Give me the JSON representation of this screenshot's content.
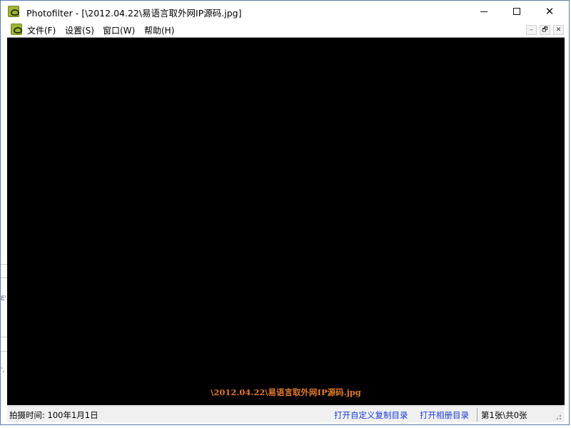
{
  "window": {
    "title": "Photofilter - [\\2012.04.22\\易语言取外网IP源码.jpg]"
  },
  "caption_buttons": {
    "minimize_icon": "minimize-icon",
    "maximize_icon": "maximize-icon",
    "close_icon": "close-icon"
  },
  "menu": {
    "items": [
      {
        "label": "文件(F)"
      },
      {
        "label": "设置(S)"
      },
      {
        "label": "窗口(W)"
      },
      {
        "label": "帮助(H)"
      }
    ]
  },
  "mdi_controls": {
    "minimize": "–",
    "restore": "🗗",
    "close": "✕"
  },
  "viewer": {
    "file_caption": "\\2012.04.22\\易语言取外网IP源码.jpg",
    "background": "#000000",
    "caption_color": "#e07a2c"
  },
  "statusbar": {
    "shot_time": "拍摄时间: 100年1月1日",
    "open_copy_dir": "打开自定义复制目录",
    "open_album_dir": "打开相册目录",
    "count": "第1张\\共0张",
    "link_color": "#1a3bd6"
  },
  "left_edge": {
    "frag1": "E'",
    "frag2": "',"
  }
}
